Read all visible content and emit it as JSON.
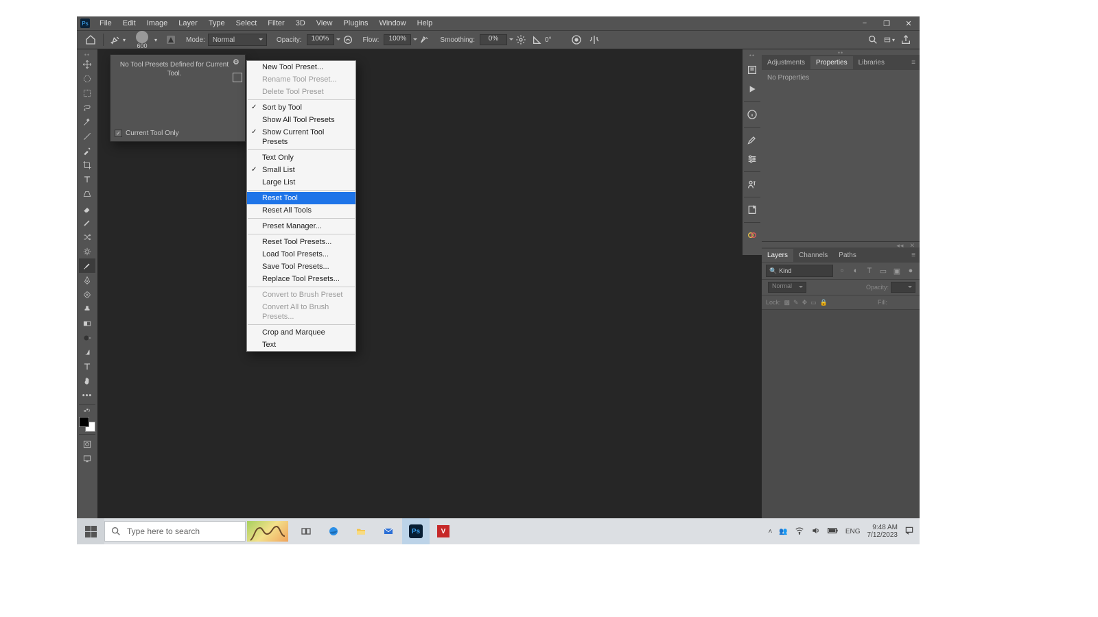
{
  "app": {
    "badge": "Ps"
  },
  "menu": [
    "File",
    "Edit",
    "Image",
    "Layer",
    "Type",
    "Select",
    "Filter",
    "3D",
    "View",
    "Plugins",
    "Window",
    "Help"
  ],
  "window_controls": {
    "min": "−",
    "max": "❐",
    "close": "✕"
  },
  "options": {
    "brush_size": "600",
    "mode_label": "Mode:",
    "mode_value": "Normal",
    "opacity_label": "Opacity:",
    "opacity_value": "100%",
    "flow_label": "Flow:",
    "flow_value": "100%",
    "smoothing_label": "Smoothing:",
    "smoothing_value": "0%",
    "angle_value": "0°"
  },
  "preset_popout": {
    "message": "No Tool Presets Defined for Current Tool.",
    "current_only": "Current Tool Only"
  },
  "context_menu": [
    {
      "label": "New Tool Preset...",
      "type": "item"
    },
    {
      "label": "Rename Tool Preset...",
      "type": "disabled"
    },
    {
      "label": "Delete Tool Preset",
      "type": "disabled"
    },
    {
      "type": "sep"
    },
    {
      "label": "Sort by Tool",
      "type": "checked"
    },
    {
      "label": "Show All Tool Presets",
      "type": "item"
    },
    {
      "label": "Show Current Tool Presets",
      "type": "checked"
    },
    {
      "type": "sep"
    },
    {
      "label": "Text Only",
      "type": "item"
    },
    {
      "label": "Small List",
      "type": "checked"
    },
    {
      "label": "Large List",
      "type": "item"
    },
    {
      "type": "sep"
    },
    {
      "label": "Reset Tool",
      "type": "hover"
    },
    {
      "label": "Reset All Tools",
      "type": "item"
    },
    {
      "type": "sep"
    },
    {
      "label": "Preset Manager...",
      "type": "item"
    },
    {
      "type": "sep"
    },
    {
      "label": "Reset Tool Presets...",
      "type": "item"
    },
    {
      "label": "Load Tool Presets...",
      "type": "item"
    },
    {
      "label": "Save Tool Presets...",
      "type": "item"
    },
    {
      "label": "Replace Tool Presets...",
      "type": "item"
    },
    {
      "type": "sep"
    },
    {
      "label": "Convert to Brush Preset",
      "type": "disabled"
    },
    {
      "label": "Convert All to Brush Presets...",
      "type": "disabled"
    },
    {
      "type": "sep"
    },
    {
      "label": "Crop and Marquee",
      "type": "item"
    },
    {
      "label": "Text",
      "type": "item"
    }
  ],
  "panels": {
    "top_tabs": [
      "Adjustments",
      "Properties",
      "Libraries"
    ],
    "top_active": 1,
    "props_body": "No Properties",
    "bottom_tabs": [
      "Layers",
      "Channels",
      "Paths"
    ],
    "bottom_active": 0,
    "kind_label": "Kind",
    "blend_mode": "Normal",
    "opacity_label": "Opacity:",
    "opacity_value": "",
    "lock_label": "Lock:",
    "fill_label": "Fill:",
    "fill_value": ""
  },
  "taskbar": {
    "search_placeholder": "Type here to search",
    "ime": "ENG",
    "time": "9:48 AM",
    "date": "7/12/2023"
  }
}
